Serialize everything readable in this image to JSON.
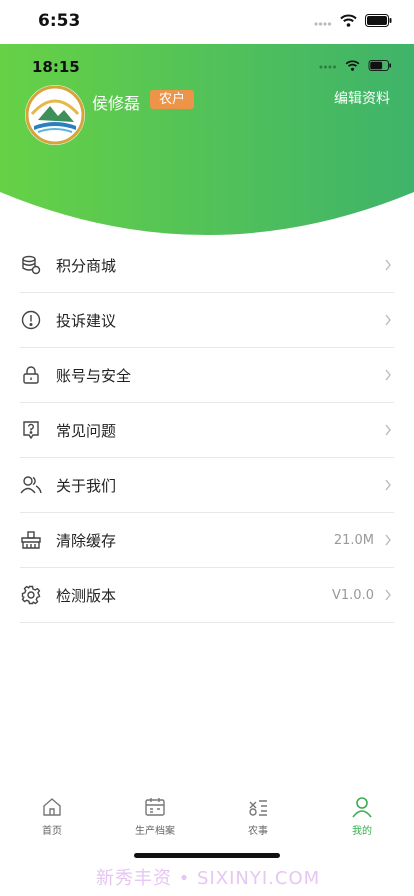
{
  "system_status": {
    "time": "6:53"
  },
  "inner_status": {
    "time": "18:15"
  },
  "profile": {
    "name": "侯修磊",
    "role": "农户",
    "edit_label": "编辑资料"
  },
  "menu": [
    {
      "label": "积分商城",
      "icon": "database-icon",
      "value": ""
    },
    {
      "label": "投诉建议",
      "icon": "exclamation-circle-icon",
      "value": ""
    },
    {
      "label": "账号与安全",
      "icon": "lock-icon",
      "value": ""
    },
    {
      "label": "常见问题",
      "icon": "question-icon",
      "value": ""
    },
    {
      "label": "关于我们",
      "icon": "users-icon",
      "value": ""
    },
    {
      "label": "清除缓存",
      "icon": "broom-icon",
      "value": "21.0M"
    },
    {
      "label": "检测版本",
      "icon": "gear-icon",
      "value": "V1.0.0"
    }
  ],
  "tabs": [
    {
      "label": "首页",
      "icon": "home-icon"
    },
    {
      "label": "生产档案",
      "icon": "calendar-icon"
    },
    {
      "label": "农事",
      "icon": "farm-work-icon"
    },
    {
      "label": "我的",
      "icon": "user-icon"
    }
  ],
  "watermark": "新秀丰资 • SIXINYI.COM",
  "colors": {
    "header_green_left": "#66d146",
    "header_green_right": "#3fb36a",
    "badge": "#ee9448",
    "active_tab": "#3bad4f"
  }
}
